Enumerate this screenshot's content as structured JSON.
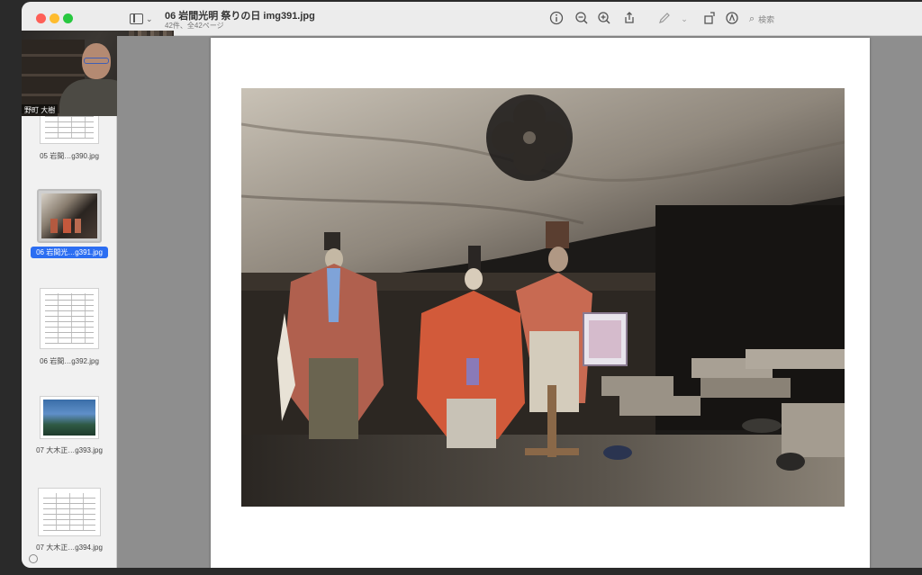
{
  "window": {
    "title": "06 岩間光明 祭りの日 img391.jpg",
    "subtitle": "42件、全42ページ"
  },
  "toolbar": {
    "icons": [
      "info-icon",
      "zoom-out-icon",
      "zoom-in-icon",
      "share-icon",
      "markup-icon",
      "rotate-icon",
      "annotate-icon"
    ],
    "search_placeholder": "検索"
  },
  "sidebar": {
    "items": [
      {
        "label": "05 岩間…g390.jpg",
        "kind": "document"
      },
      {
        "label": "06 岩間光…g391.jpg",
        "kind": "photo",
        "selected": true
      },
      {
        "label": "06 岩間…g392.jpg",
        "kind": "document"
      },
      {
        "label": "07 大木正…g393.jpg",
        "kind": "landscape"
      },
      {
        "label": "07 大木正…g394.jpg",
        "kind": "document"
      }
    ]
  },
  "webcam": {
    "name": "野町 大樹"
  },
  "colors": {
    "selection": "#2c6ef2",
    "close": "#fe5f57",
    "minimize": "#febc2e",
    "maximize": "#28c840"
  }
}
